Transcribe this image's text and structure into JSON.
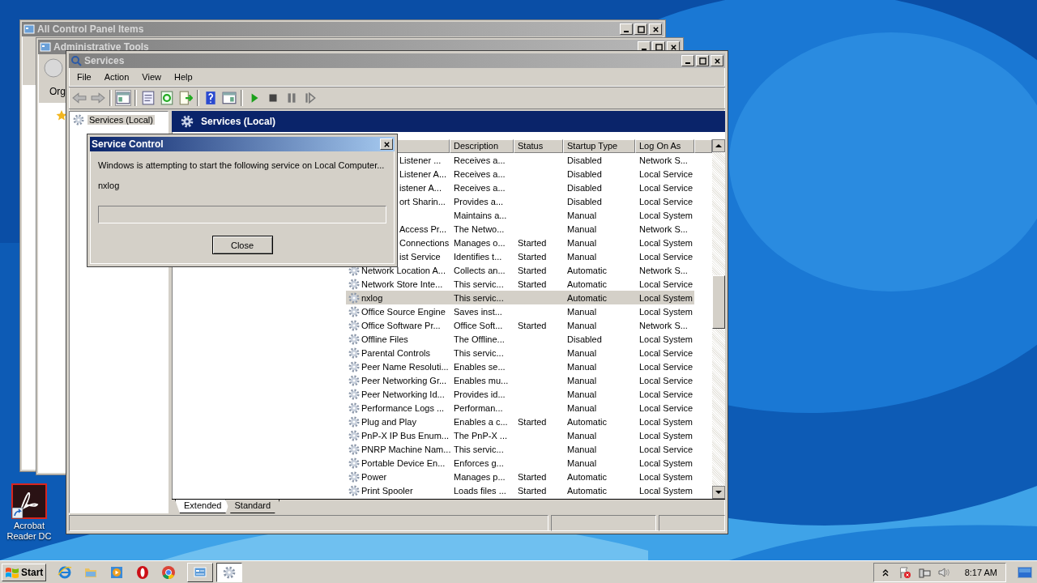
{
  "desktop_icons": [
    {
      "label": "Acrobat Reader DC"
    }
  ],
  "windows_behind": [
    {
      "title": "All Control Panel Items"
    },
    {
      "title": "Administrative Tools",
      "toolbar_text": "Org"
    }
  ],
  "services": {
    "title": "Services",
    "menu": [
      "File",
      "Action",
      "View",
      "Help"
    ],
    "tree": [
      {
        "label": "Services (Local)",
        "selected": true
      }
    ],
    "banner": "Services (Local)",
    "columns": [
      "Description",
      "Status",
      "Startup Type",
      "Log On As"
    ],
    "rows": [
      {
        "name": "Listener ...",
        "description": "Receives a...",
        "startup": "Disabled",
        "log_on_as": "Network S...",
        "covered": true,
        "selected": false
      },
      {
        "name": "Listener A...",
        "description": "Receives a...",
        "startup": "Disabled",
        "log_on_as": "Local Service",
        "covered": true,
        "selected": false
      },
      {
        "name": "istener A...",
        "description": "Receives a...",
        "startup": "Disabled",
        "log_on_as": "Local Service",
        "covered": true,
        "selected": false
      },
      {
        "name": "ort Sharin...",
        "description": "Provides a...",
        "startup": "Disabled",
        "log_on_as": "Local Service",
        "covered": true,
        "selected": false
      },
      {
        "description": "Maintains a...",
        "startup": "Manual",
        "log_on_as": "Local System",
        "selected": false
      },
      {
        "name": "Access Pr...",
        "description": "The Netwo...",
        "startup": "Manual",
        "log_on_as": "Network S...",
        "covered": true,
        "selected": false
      },
      {
        "name": "Connections",
        "description": "Manages o...",
        "status": "Started",
        "startup": "Manual",
        "log_on_as": "Local System",
        "covered": true,
        "selected": false
      },
      {
        "name": "ist Service",
        "description": "Identifies t...",
        "status": "Started",
        "startup": "Manual",
        "log_on_as": "Local Service",
        "covered": true,
        "selected": false
      },
      {
        "name": "Network Location A...",
        "description": "Collects an...",
        "status": "Started",
        "startup": "Automatic",
        "log_on_as": "Network S...",
        "covered": false,
        "selected": false
      },
      {
        "name": "Network Store Inte...",
        "description": "This servic...",
        "status": "Started",
        "startup": "Automatic",
        "log_on_as": "Local Service",
        "covered": false,
        "selected": false
      },
      {
        "name": "nxlog",
        "description": "This servic...",
        "startup": "Automatic",
        "log_on_as": "Local System",
        "covered": false,
        "selected": true
      },
      {
        "name": "Office  Source Engine",
        "description": "Saves inst...",
        "startup": "Manual",
        "log_on_as": "Local System",
        "covered": false,
        "selected": false
      },
      {
        "name": "Office Software Pr...",
        "description": "Office Soft...",
        "status": "Started",
        "startup": "Manual",
        "log_on_as": "Network S...",
        "covered": false,
        "selected": false
      },
      {
        "name": "Offline Files",
        "description": "The Offline...",
        "startup": "Disabled",
        "log_on_as": "Local System",
        "covered": false,
        "selected": false
      },
      {
        "name": "Parental Controls",
        "description": "This servic...",
        "startup": "Manual",
        "log_on_as": "Local Service",
        "covered": false,
        "selected": false
      },
      {
        "name": "Peer Name Resoluti...",
        "description": "Enables se...",
        "startup": "Manual",
        "log_on_as": "Local Service",
        "covered": false,
        "selected": false
      },
      {
        "name": "Peer Networking Gr...",
        "description": "Enables mu...",
        "startup": "Manual",
        "log_on_as": "Local Service",
        "covered": false,
        "selected": false
      },
      {
        "name": "Peer Networking Id...",
        "description": "Provides id...",
        "startup": "Manual",
        "log_on_as": "Local Service",
        "covered": false,
        "selected": false
      },
      {
        "name": "Performance Logs ...",
        "description": "Performan...",
        "startup": "Manual",
        "log_on_as": "Local Service",
        "covered": false,
        "selected": false
      },
      {
        "name": "Plug and Play",
        "description": "Enables a c...",
        "status": "Started",
        "startup": "Automatic",
        "log_on_as": "Local System",
        "covered": false,
        "selected": false
      },
      {
        "name": "PnP-X IP Bus Enum...",
        "description": "The PnP-X ...",
        "startup": "Manual",
        "log_on_as": "Local System",
        "covered": false,
        "selected": false
      },
      {
        "name": "PNRP Machine Nam...",
        "description": "This servic...",
        "startup": "Manual",
        "log_on_as": "Local Service",
        "covered": false,
        "selected": false
      },
      {
        "name": "Portable Device En...",
        "description": "Enforces g...",
        "startup": "Manual",
        "log_on_as": "Local System",
        "covered": false,
        "selected": false
      },
      {
        "name": "Power",
        "description": "Manages p...",
        "status": "Started",
        "startup": "Automatic",
        "log_on_as": "Local System",
        "covered": false,
        "selected": false
      },
      {
        "name": "Print Spooler",
        "description": "Loads files ...",
        "status": "Started",
        "startup": "Automatic",
        "log_on_as": "Local System",
        "covered": false,
        "selected": false
      }
    ],
    "tabs": [
      {
        "label": "Extended",
        "selected": true
      },
      {
        "label": "Standard",
        "selected": false
      }
    ]
  },
  "dialog": {
    "title": "Service Control",
    "message": "Windows is attempting to start the following service on Local Computer...",
    "service": "nxlog",
    "level": 0,
    "button": "Close"
  },
  "taskbar": {
    "start": "Start",
    "clock": "8:17 AM"
  }
}
